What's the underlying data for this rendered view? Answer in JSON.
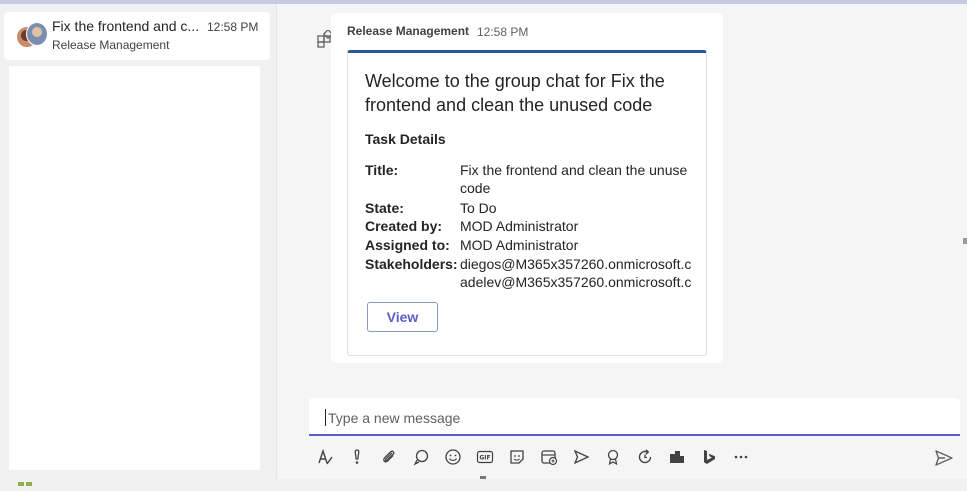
{
  "chat_list": {
    "items": [
      {
        "title": "Fix the frontend and c...",
        "time": "12:58 PM",
        "subtitle": "Release Management"
      }
    ]
  },
  "message": {
    "sender": "Release Management",
    "time": "12:58 PM",
    "card": {
      "title": "Welcome to the group chat for Fix the frontend and clean the unused code",
      "section": "Task Details",
      "facts": [
        {
          "key": "Title:",
          "value": "Fix the frontend and clean the unuse code"
        },
        {
          "key": "State:",
          "value": "To Do"
        },
        {
          "key": "Created by:",
          "value": "MOD Administrator"
        },
        {
          "key": "Assigned to:",
          "value": "MOD Administrator"
        },
        {
          "key": "Stakeholders:",
          "value": "diegos@M365x357260.onmicrosoft.c",
          "value2": "adelev@M365x357260.onmicrosoft.c"
        }
      ],
      "button": "View"
    }
  },
  "composer": {
    "placeholder": "Type a new message"
  },
  "toolbar": {
    "icons": [
      "format-icon",
      "important-icon",
      "attach-icon",
      "loop-icon",
      "emoji-icon",
      "gif-icon",
      "sticker-icon",
      "schedule-meeting-icon",
      "stream-icon",
      "praise-icon",
      "updates-icon",
      "app-icon",
      "bing-icon",
      "more-icon"
    ],
    "accent": "#5b5fc7"
  },
  "colors": {
    "accent": "#5b5fc7",
    "card_border_top": "#2b5797"
  }
}
